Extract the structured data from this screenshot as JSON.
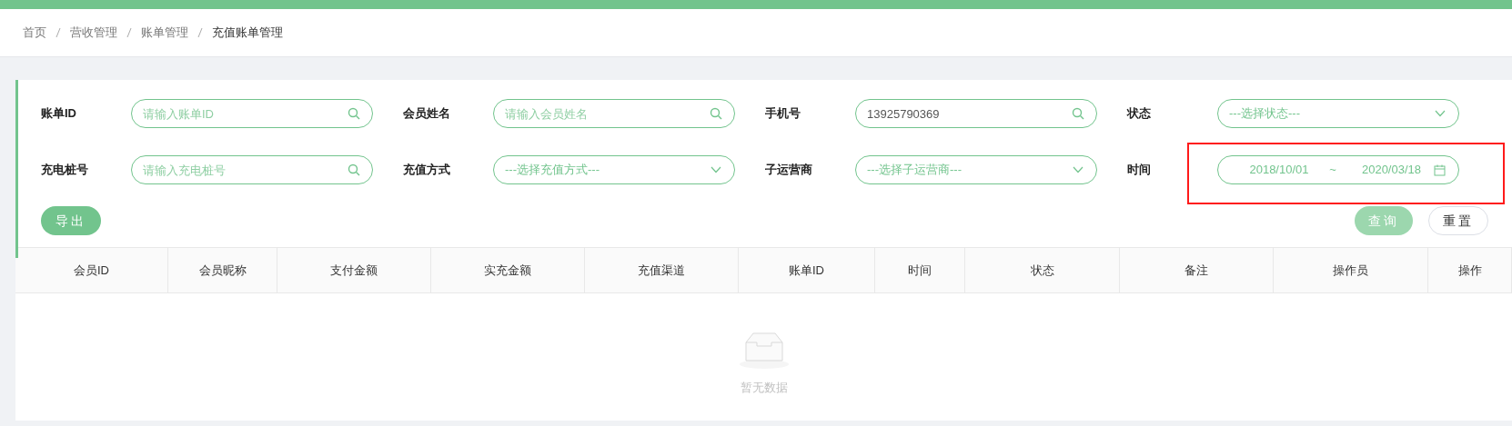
{
  "breadcrumb": [
    "首页",
    "营收管理",
    "账单管理",
    "充值账单管理"
  ],
  "filters": [
    {
      "kind": "search",
      "label": "账单ID",
      "placeholder": "请输入账单ID"
    },
    {
      "kind": "search",
      "label": "会员姓名",
      "placeholder": "请输入会员姓名"
    },
    {
      "kind": "search",
      "label": "手机号",
      "value": "13925790369"
    },
    {
      "kind": "select",
      "label": "状态",
      "placeholder": "---选择状态---"
    },
    {
      "kind": "search",
      "label": "充电桩号",
      "placeholder": "请输入充电桩号"
    },
    {
      "kind": "select",
      "label": "充值方式",
      "placeholder": "---选择充值方式---"
    },
    {
      "kind": "select",
      "label": "子运营商",
      "placeholder": "---选择子运营商---"
    },
    {
      "kind": "date_range",
      "label": "时间",
      "start": "2018/10/01",
      "separator": "~",
      "end": "2020/03/18",
      "highlighted": true
    }
  ],
  "export_button": "导出",
  "query_button": "查询",
  "reset_button": "重置",
  "table": {
    "columns": [
      "会员ID",
      "会员昵称",
      "支付金额",
      "实充金额",
      "充值渠道",
      "账单ID",
      "时间",
      "状态",
      "备注",
      "操作员",
      "操作"
    ],
    "empty_text": "暂无数据"
  }
}
